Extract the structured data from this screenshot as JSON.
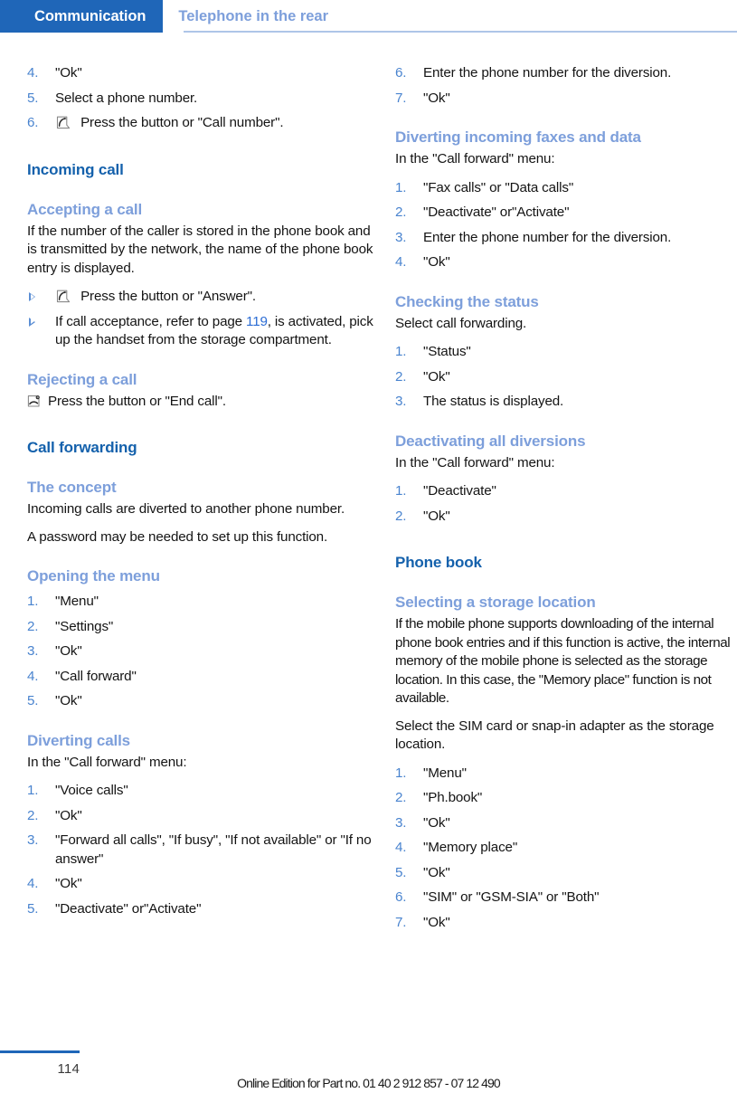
{
  "header": {
    "active_tab": "Communication",
    "inactive_tab": "Telephone in the rear",
    "active_bg": "#1f66b8",
    "inactive_color": "#7d9fdb"
  },
  "colors": {
    "h2": "#1461ac",
    "h3": "#7d9fdb",
    "list_number": "#4a84cf",
    "page_reference": "#2b6cd4",
    "body": "#141414"
  },
  "left_column": {
    "continued_steps": [
      {
        "num": "4.",
        "text": "\"Ok\""
      },
      {
        "num": "5.",
        "text": "Select a phone number."
      },
      {
        "num": "6.",
        "icon": "phone-handset-icon",
        "text": "Press the button or \"Call number\"."
      }
    ],
    "incoming_call": {
      "heading": "Incoming call",
      "accepting": {
        "heading": "Accepting a call",
        "paragraph": "If the number of the caller is stored in the phone book and is transmitted by the network, the name of the phone book entry is displayed.",
        "bullets": [
          {
            "icon": "phone-handset-icon",
            "text": "Press the button or \"Answer\"."
          },
          {
            "text_before": "If call acceptance, refer to page ",
            "page_ref": "119",
            "text_after": ", is activated, pick up the handset from the storage compartment."
          }
        ]
      },
      "rejecting": {
        "heading": "Rejecting a call",
        "icon": "phone-hangup-icon",
        "text": "Press the button or \"End call\"."
      }
    },
    "call_forwarding": {
      "heading": "Call forwarding",
      "concept": {
        "heading": "The concept",
        "paragraph_1": "Incoming calls are diverted to another phone number.",
        "paragraph_2": "A password may be needed to set up this function."
      },
      "opening_menu": {
        "heading": "Opening the menu",
        "steps": [
          {
            "num": "1.",
            "text": "\"Menu\""
          },
          {
            "num": "2.",
            "text": "\"Settings\""
          },
          {
            "num": "3.",
            "text": "\"Ok\""
          },
          {
            "num": "4.",
            "text": "\"Call forward\""
          },
          {
            "num": "5.",
            "text": "\"Ok\""
          }
        ]
      },
      "diverting_calls": {
        "heading": "Diverting calls",
        "intro": "In the \"Call forward\" menu:",
        "steps": [
          {
            "num": "1.",
            "text": "\"Voice calls\""
          },
          {
            "num": "2.",
            "text": "\"Ok\""
          },
          {
            "num": "3.",
            "text": "\"Forward all calls\", \"If busy\", \"If not available\" or \"If no answer\""
          },
          {
            "num": "4.",
            "text": "\"Ok\""
          },
          {
            "num": "5.",
            "text": "\"Deactivate\" or\"Activate\""
          }
        ]
      }
    }
  },
  "right_column": {
    "diverting_calls_continued": [
      {
        "num": "6.",
        "text": "Enter the phone number for the diversion."
      },
      {
        "num": "7.",
        "text": "\"Ok\""
      }
    ],
    "diverting_faxes": {
      "heading": "Diverting incoming faxes and data",
      "intro": "In the \"Call forward\" menu:",
      "steps": [
        {
          "num": "1.",
          "text": "\"Fax calls\" or \"Data calls\""
        },
        {
          "num": "2.",
          "text": "\"Deactivate\" or\"Activate\""
        },
        {
          "num": "3.",
          "text": "Enter the phone number for the diversion."
        },
        {
          "num": "4.",
          "text": "\"Ok\""
        }
      ]
    },
    "checking_status": {
      "heading": "Checking the status",
      "intro": "Select call forwarding.",
      "steps": [
        {
          "num": "1.",
          "text": "\"Status\""
        },
        {
          "num": "2.",
          "text": "\"Ok\""
        },
        {
          "num": "3.",
          "text": "The status is displayed."
        }
      ]
    },
    "deactivating_all": {
      "heading": "Deactivating all diversions",
      "intro": "In the \"Call forward\" menu:",
      "steps": [
        {
          "num": "1.",
          "text": "\"Deactivate\""
        },
        {
          "num": "2.",
          "text": "\"Ok\""
        }
      ]
    },
    "phone_book": {
      "heading": "Phone book",
      "storage_location": {
        "heading": "Selecting a storage location",
        "paragraph_1": "If the mobile phone supports downloading of the internal phone book entries and if this function is active, the internal memory of the mobile phone is selected as the storage location. In this case, the \"Memory place\" function is not available.",
        "paragraph_2": "Select the SIM card or snap-in adapter as the storage location.",
        "steps": [
          {
            "num": "1.",
            "text": "\"Menu\""
          },
          {
            "num": "2.",
            "text": "\"Ph.book\""
          },
          {
            "num": "3.",
            "text": "\"Ok\""
          },
          {
            "num": "4.",
            "text": "\"Memory place\""
          },
          {
            "num": "5.",
            "text": "\"Ok\""
          },
          {
            "num": "6.",
            "text": "\"SIM\" or \"GSM-SIA\" or \"Both\""
          },
          {
            "num": "7.",
            "text": "\"Ok\""
          }
        ]
      }
    }
  },
  "footer": {
    "page_number": "114",
    "note": "Online Edition for Part no. 01 40 2 912 857 - 07 12 490"
  }
}
